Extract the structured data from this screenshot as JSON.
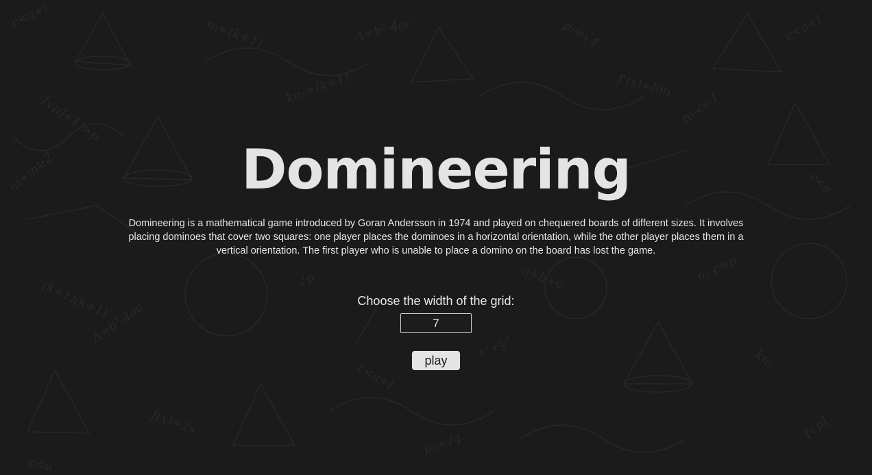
{
  "header": {
    "title": "Domineering"
  },
  "intro": {
    "description": "Domineering is a mathematical game introduced by Goran Andersson in 1974 and played on chequered boards of different sizes. It involves placing dominoes that cover two squares: one player places the dominoes in a horizontal orientation, while the other player places them in a vertical orientation. The first player who is unable to place a domino on the board has lost the game."
  },
  "settings": {
    "grid_width_label": "Choose the width of the grid:",
    "grid_width_value": "7"
  },
  "actions": {
    "play_label": "play"
  },
  "colors": {
    "background": "#1b1b1b",
    "text": "#e6e6e6",
    "button": "#e4e4e4"
  }
}
